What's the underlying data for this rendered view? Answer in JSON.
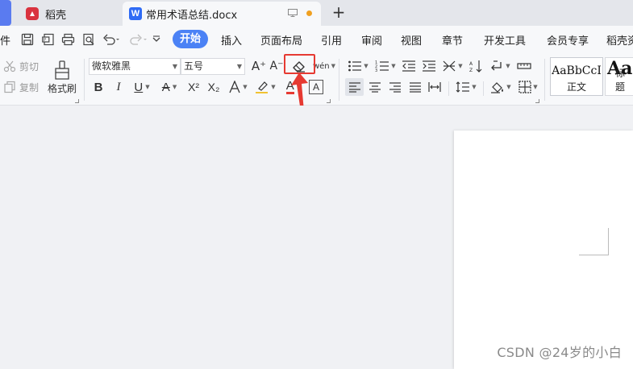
{
  "tabs": {
    "left_fragment": "",
    "daoke": "稻壳",
    "document": "常用术语总结.docx",
    "new_tab": "+"
  },
  "menubar": {
    "file_fragment": "件",
    "active": "开始",
    "items": [
      "插入",
      "页面布局",
      "引用",
      "审阅",
      "视图",
      "章节",
      "开发工具",
      "会员专享",
      "稻壳资"
    ]
  },
  "ribbon": {
    "cut": "剪切",
    "copy": "复制",
    "format_painter": "格式刷",
    "font_name": "微软雅黑",
    "font_size": "五号",
    "bold": "B",
    "italic": "I",
    "underline": "U",
    "strikethrough": "A",
    "superscript": "X²",
    "subscript": "X₂",
    "font_color_letter": "A",
    "char_border_letter": "A",
    "grow_font": "A⁺",
    "shrink_font": "A⁻",
    "phonetic": "wén",
    "style_normal_sample": "AaBbCcI",
    "style_normal_label": "正文",
    "style_heading_sample": "Aa",
    "style_heading_label": "标题"
  },
  "colors": {
    "accent": "#4b82f5",
    "highlight": "#e63a32",
    "doc_icon": "#2f6bf5",
    "daoke_icon": "#d9333f",
    "unsaved_dot": "#f0a020"
  },
  "watermark": "CSDN @24岁的小白"
}
